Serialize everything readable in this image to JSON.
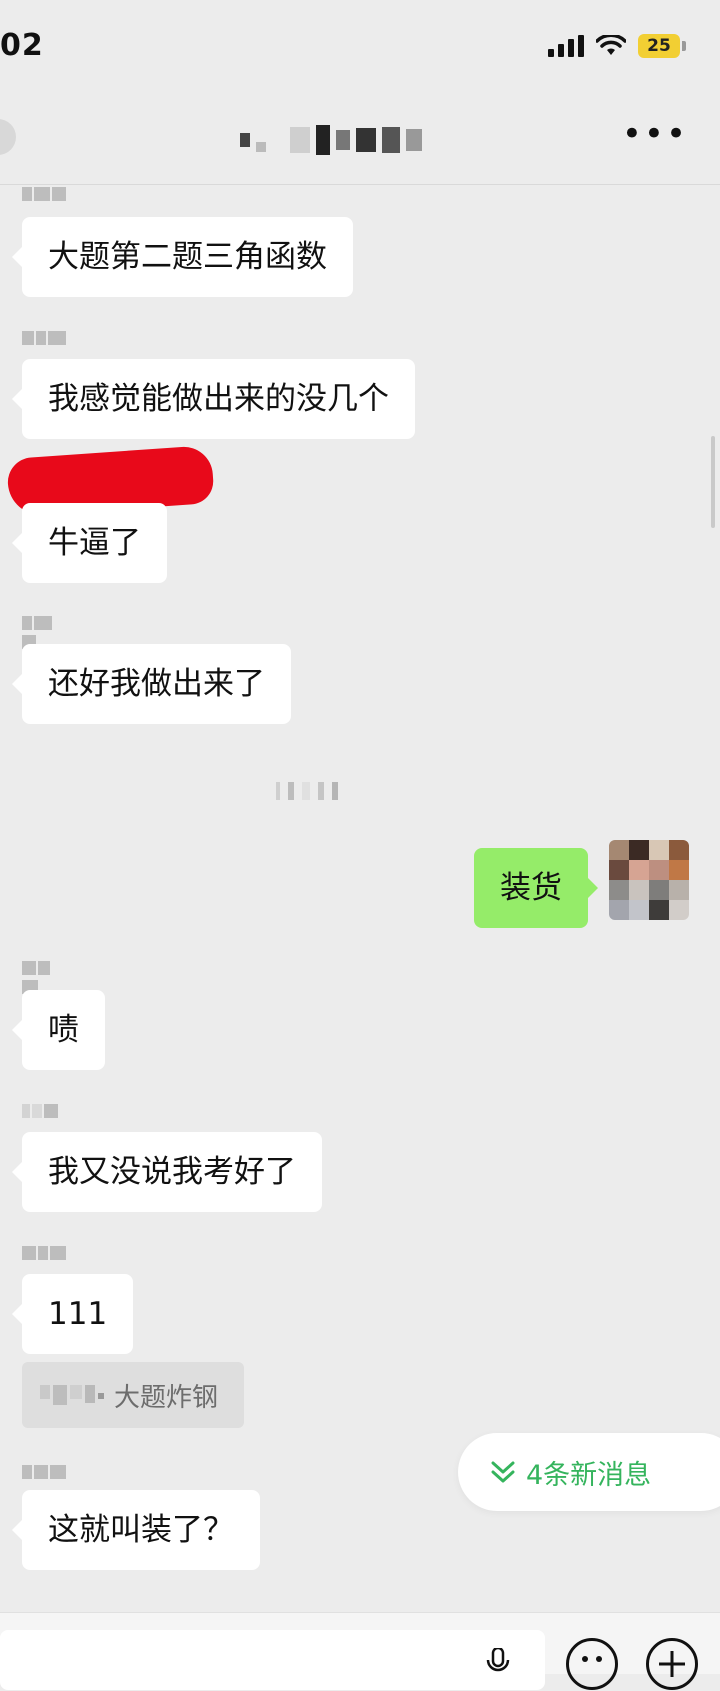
{
  "status_bar": {
    "time": "02",
    "battery": "25"
  },
  "messages": [
    {
      "text": "大题第二题三角函数"
    },
    {
      "text": "我感觉能做出来的没几个"
    },
    {
      "text": "牛逼了"
    },
    {
      "text": "还好我做出来了"
    },
    {
      "text": "装货"
    },
    {
      "text": "啧"
    },
    {
      "text": "我又没说我考好了"
    },
    {
      "text": "111"
    },
    {
      "text": "这就叫装了？"
    }
  ],
  "quote": {
    "text": "大题炸钢"
  },
  "new_messages_pill": {
    "label": "4条新消息"
  },
  "colors": {
    "background": "#ececec",
    "my_bubble": "#95ec69",
    "accent_green": "#35b45d",
    "redaction": "#e8091a"
  },
  "icons": [
    "signal-icon",
    "wifi-icon",
    "battery-icon",
    "back-icon",
    "more-icon",
    "voice-icon",
    "emoji-icon",
    "plus-icon",
    "double-chevron-down-icon"
  ]
}
